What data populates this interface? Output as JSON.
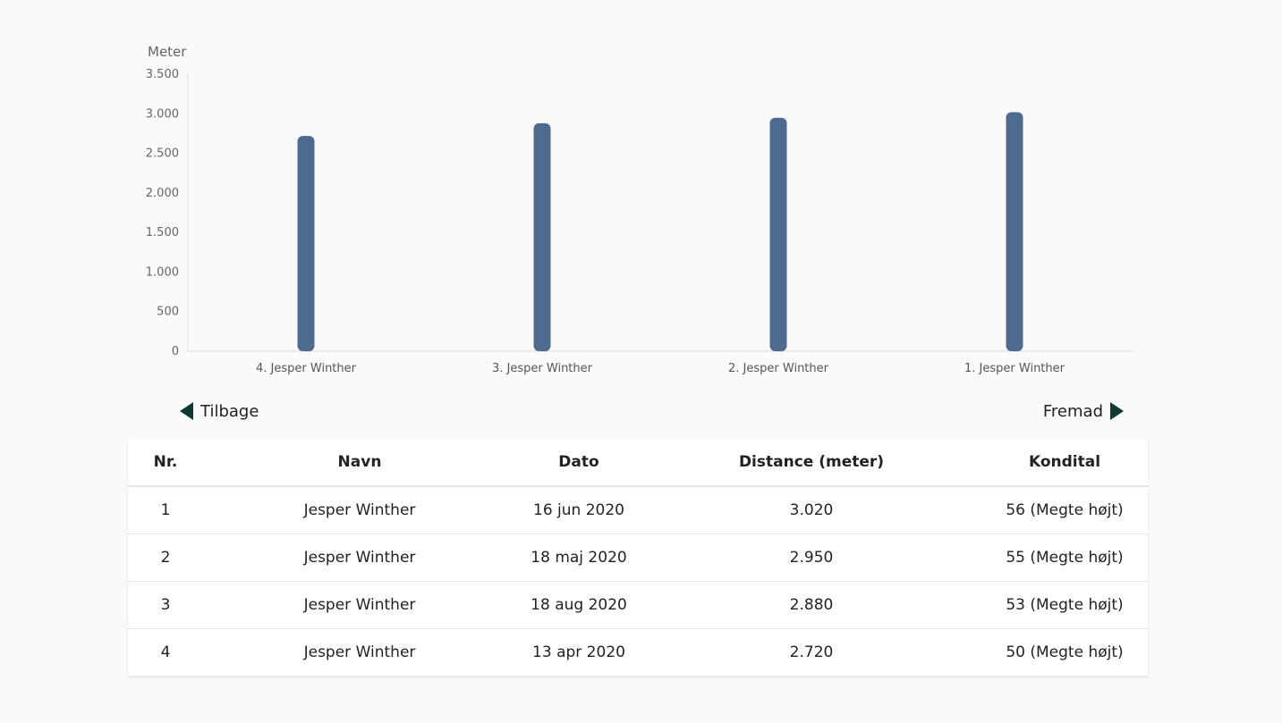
{
  "chart_data": {
    "type": "bar",
    "ylabel": "Meter",
    "xlabel": "",
    "title": "",
    "ylim": [
      0,
      3500
    ],
    "yticks": [
      "0",
      "500",
      "1.000",
      "1.500",
      "2.000",
      "2.500",
      "3.000",
      "3.500"
    ],
    "ytick_values": [
      0,
      500,
      1000,
      1500,
      2000,
      2500,
      3000,
      3500
    ],
    "categories": [
      "4. Jesper  Winther",
      "3. Jesper  Winther",
      "2. Jesper  Winther",
      "1. Jesper  Winther"
    ],
    "values": [
      2720,
      2880,
      2950,
      3020
    ],
    "bar_color": "#4f6a8f",
    "grid": false
  },
  "nav": {
    "back_label": "Tilbage",
    "forward_label": "Fremad",
    "arrow_color": "#0e3a33"
  },
  "table": {
    "headers": {
      "nr": "Nr.",
      "navn": "Navn",
      "dato": "Dato",
      "distance": "Distance (meter)",
      "kondital": "Kondital"
    },
    "rows": [
      {
        "nr": "1",
        "navn": "Jesper Winther",
        "dato": "16 jun 2020",
        "distance": "3.020",
        "kondital": "56 (Megte højt)"
      },
      {
        "nr": "2",
        "navn": "Jesper Winther",
        "dato": "18 maj 2020",
        "distance": "2.950",
        "kondital": "55 (Megte højt)"
      },
      {
        "nr": "3",
        "navn": "Jesper Winther",
        "dato": "18 aug 2020",
        "distance": "2.880",
        "kondital": "53 (Megte højt)"
      },
      {
        "nr": "4",
        "navn": "Jesper Winther",
        "dato": "13 apr 2020",
        "distance": "2.720",
        "kondital": "50 (Megte højt)"
      }
    ]
  }
}
